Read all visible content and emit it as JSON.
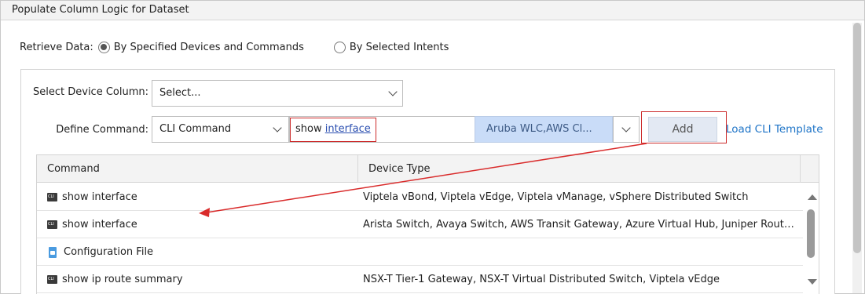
{
  "panel": {
    "title": "Populate Column Logic for Dataset"
  },
  "retrieve": {
    "label": "Retrieve Data:",
    "options": [
      {
        "label": "By Specified Devices and Commands",
        "selected": true
      },
      {
        "label": "By Selected Intents",
        "selected": false
      }
    ]
  },
  "device_column": {
    "label": "Select Device Column:",
    "value": "Select..."
  },
  "define_command": {
    "label": "Define Command:",
    "type_value": "CLI Command",
    "command_prefix": "show ",
    "command_underlined": "interface",
    "device_types": "Aruba WLC,AWS Cl...",
    "add_label": "Add",
    "load_template_label": "Load CLI Template"
  },
  "table": {
    "headers": [
      "Command",
      "Device Type"
    ],
    "rows": [
      {
        "icon": "cli-icon",
        "command": "show interface",
        "device_type": "Viptela vBond, Viptela vEdge, Viptela vManage, vSphere Distributed Switch"
      },
      {
        "icon": "cli-icon",
        "command": "show interface",
        "device_type": "Arista Switch, Avaya Switch, AWS Transit Gateway, Azure Virtual Hub, Juniper Router..."
      },
      {
        "icon": "config-file-icon",
        "command": "Configuration File",
        "device_type": ""
      },
      {
        "icon": "cli-icon",
        "command": "show ip route summary",
        "device_type": "NSX-T Tier-1 Gateway, NSX-T Virtual Distributed Switch, Viptela vEdge"
      }
    ]
  },
  "colors": {
    "highlight_red": "#cc2b2b",
    "link_blue": "#1e74c7",
    "device_type_bg": "#c9dcf8"
  }
}
